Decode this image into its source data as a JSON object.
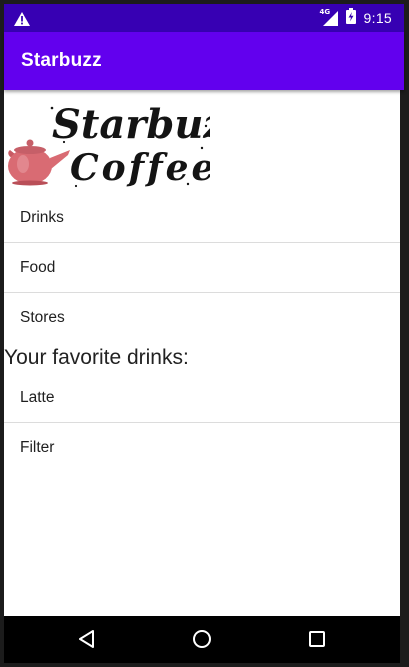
{
  "status_bar": {
    "network_label": "4G",
    "time": "9:15",
    "icons": [
      "alert-icon",
      "signal-icon",
      "battery-charging-icon"
    ]
  },
  "app_bar": {
    "title": "Starbuzz"
  },
  "logo": {
    "text_line1": "Starbuzz",
    "text_line2": "Coffee"
  },
  "menu": {
    "items": [
      {
        "label": "Drinks"
      },
      {
        "label": "Food"
      },
      {
        "label": "Stores"
      }
    ]
  },
  "favorites": {
    "heading": "Your favorite drinks:",
    "items": [
      {
        "label": "Latte"
      },
      {
        "label": "Filter"
      }
    ]
  },
  "nav_bar": {
    "icons": [
      "back-icon",
      "home-icon",
      "recents-icon"
    ]
  },
  "colors": {
    "primary": "#6200ee",
    "primary_dark": "#3700b3",
    "teapot": "#d96b73"
  }
}
